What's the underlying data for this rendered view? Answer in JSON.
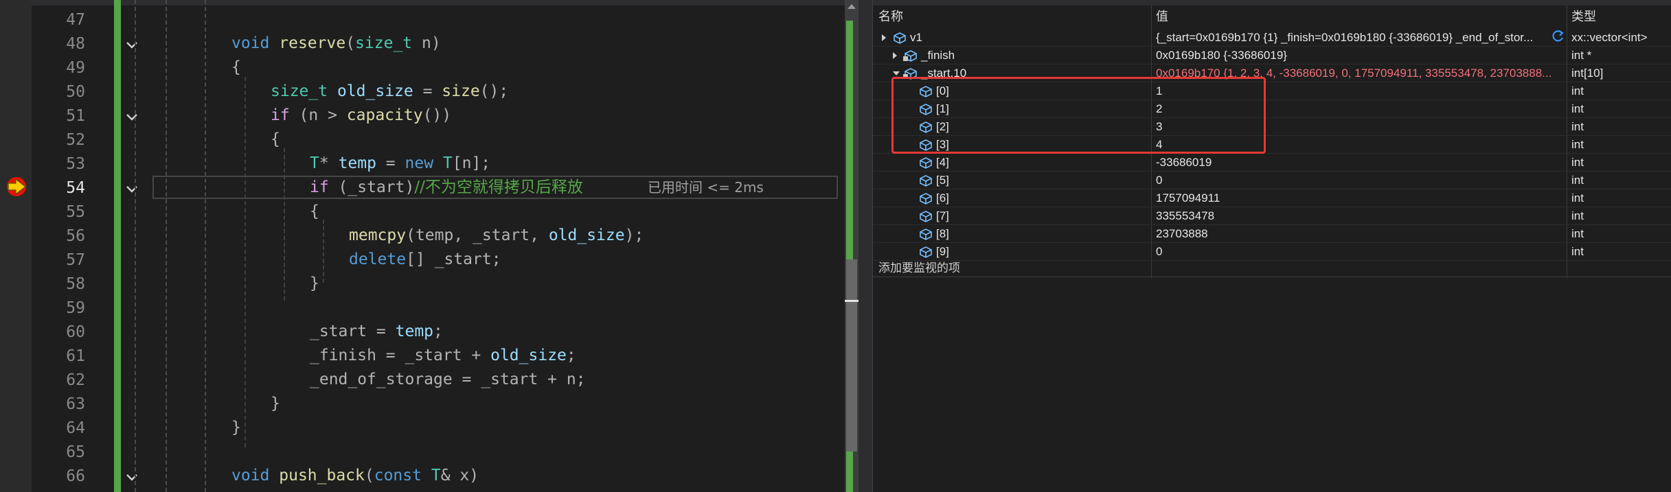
{
  "editor": {
    "lines": [
      {
        "num": "47",
        "fold": false
      },
      {
        "num": "48",
        "fold": true
      },
      {
        "num": "49",
        "fold": false
      },
      {
        "num": "50",
        "fold": false
      },
      {
        "num": "51",
        "fold": true
      },
      {
        "num": "52",
        "fold": false
      },
      {
        "num": "53",
        "fold": false
      },
      {
        "num": "54",
        "fold": true,
        "current": true
      },
      {
        "num": "55",
        "fold": false
      },
      {
        "num": "56",
        "fold": false
      },
      {
        "num": "57",
        "fold": false
      },
      {
        "num": "58",
        "fold": false
      },
      {
        "num": "59",
        "fold": false
      },
      {
        "num": "60",
        "fold": false
      },
      {
        "num": "61",
        "fold": false
      },
      {
        "num": "62",
        "fold": false
      },
      {
        "num": "63",
        "fold": false
      },
      {
        "num": "64",
        "fold": false
      },
      {
        "num": "65",
        "fold": false
      },
      {
        "num": "66",
        "fold": true
      }
    ],
    "code": {
      "l48": {
        "kw": "void",
        "fn": "reserve",
        "p1": "(",
        "ty": "size_t",
        "rest": " n)"
      },
      "l49": {
        "t": "{"
      },
      "l50": {
        "ty": "size_t",
        "var": "old_size",
        "eq": " = ",
        "fn": "size",
        "rest": "();"
      },
      "l51": {
        "kw": "if",
        "a": " (n > ",
        "fn": "capacity",
        "rest": "())"
      },
      "l52": {
        "t": "{"
      },
      "l53": {
        "ty": "T",
        "star": "* ",
        "var": "temp",
        "eq": " = ",
        "kw": "new",
        "sp": " ",
        "ty2": "T",
        "rest": "[n];"
      },
      "l54": {
        "kw": "if",
        "a": " (_start)",
        "cm": "//不为空就得拷贝后释放"
      },
      "l55": {
        "t": "{"
      },
      "l56": {
        "fn": "memcpy",
        "a": "(temp, _start, ",
        "var": "old_size",
        "rest": ");"
      },
      "l57": {
        "kw": "delete",
        "rest": "[] _start;"
      },
      "l58": {
        "t": "}"
      },
      "l60": {
        "a": "_start = ",
        "var": "temp",
        "rest": ";"
      },
      "l61": {
        "a": "_finish = _start + ",
        "var": "old_size",
        "rest": ";"
      },
      "l62": {
        "a": "_end_of_storage = _start + n;"
      },
      "l63": {
        "t": "}"
      },
      "l64": {
        "t": "}"
      },
      "l66": {
        "kw": "void",
        "fn": "push_back",
        "p1": "(",
        "kw2": "const",
        "sp": " ",
        "ty": "T",
        "rest": "& x)"
      }
    },
    "elapsed_hint": "已用时间 <= 2ms"
  },
  "watch": {
    "headers": {
      "name": "名称",
      "value": "值",
      "type": "类型"
    },
    "rows": [
      {
        "name": "v1",
        "value": "{_start=0x0169b170 {1} _finish=0x0169b180 {-33686019} _end_of_stor...",
        "type": "xx::vector<int>",
        "indent": 0,
        "expander": "right",
        "icon": "variable"
      },
      {
        "name": "_finish",
        "value": "0x0169b180 {-33686019}",
        "type": "int *",
        "indent": 1,
        "expander": "right",
        "icon": "private-field"
      },
      {
        "name": "_start,10",
        "value": "0x0169b170 {1, 2, 3, 4, -33686019, 0, 1757094911, 335553478, 23703888...",
        "type": "int[10]",
        "indent": 1,
        "expander": "down",
        "icon": "private-field",
        "changed": true
      },
      {
        "name": "[0]",
        "value": "1",
        "type": "int",
        "indent": 2,
        "icon": "variable"
      },
      {
        "name": "[1]",
        "value": "2",
        "type": "int",
        "indent": 2,
        "icon": "variable"
      },
      {
        "name": "[2]",
        "value": "3",
        "type": "int",
        "indent": 2,
        "icon": "variable"
      },
      {
        "name": "[3]",
        "value": "4",
        "type": "int",
        "indent": 2,
        "icon": "variable"
      },
      {
        "name": "[4]",
        "value": "-33686019",
        "type": "int",
        "indent": 2,
        "icon": "variable"
      },
      {
        "name": "[5]",
        "value": "0",
        "type": "int",
        "indent": 2,
        "icon": "variable"
      },
      {
        "name": "[6]",
        "value": "1757094911",
        "type": "int",
        "indent": 2,
        "icon": "variable"
      },
      {
        "name": "[7]",
        "value": "335553478",
        "type": "int",
        "indent": 2,
        "icon": "variable"
      },
      {
        "name": "[8]",
        "value": "23703888",
        "type": "int",
        "indent": 2,
        "icon": "variable"
      },
      {
        "name": "[9]",
        "value": "0",
        "type": "int",
        "indent": 2,
        "icon": "variable"
      }
    ],
    "add_watch": "添加要监视的项"
  },
  "colors": {
    "editor_bg": "#1e1e1e",
    "keyword": "#569cd6",
    "function": "#dcdcaa",
    "type": "#4ec9b0",
    "variable": "#9cdcfe",
    "comment": "#57a64a",
    "changed_value": "#f1707b",
    "highlight_box": "#e53935",
    "change_bar": "#57a64a"
  }
}
